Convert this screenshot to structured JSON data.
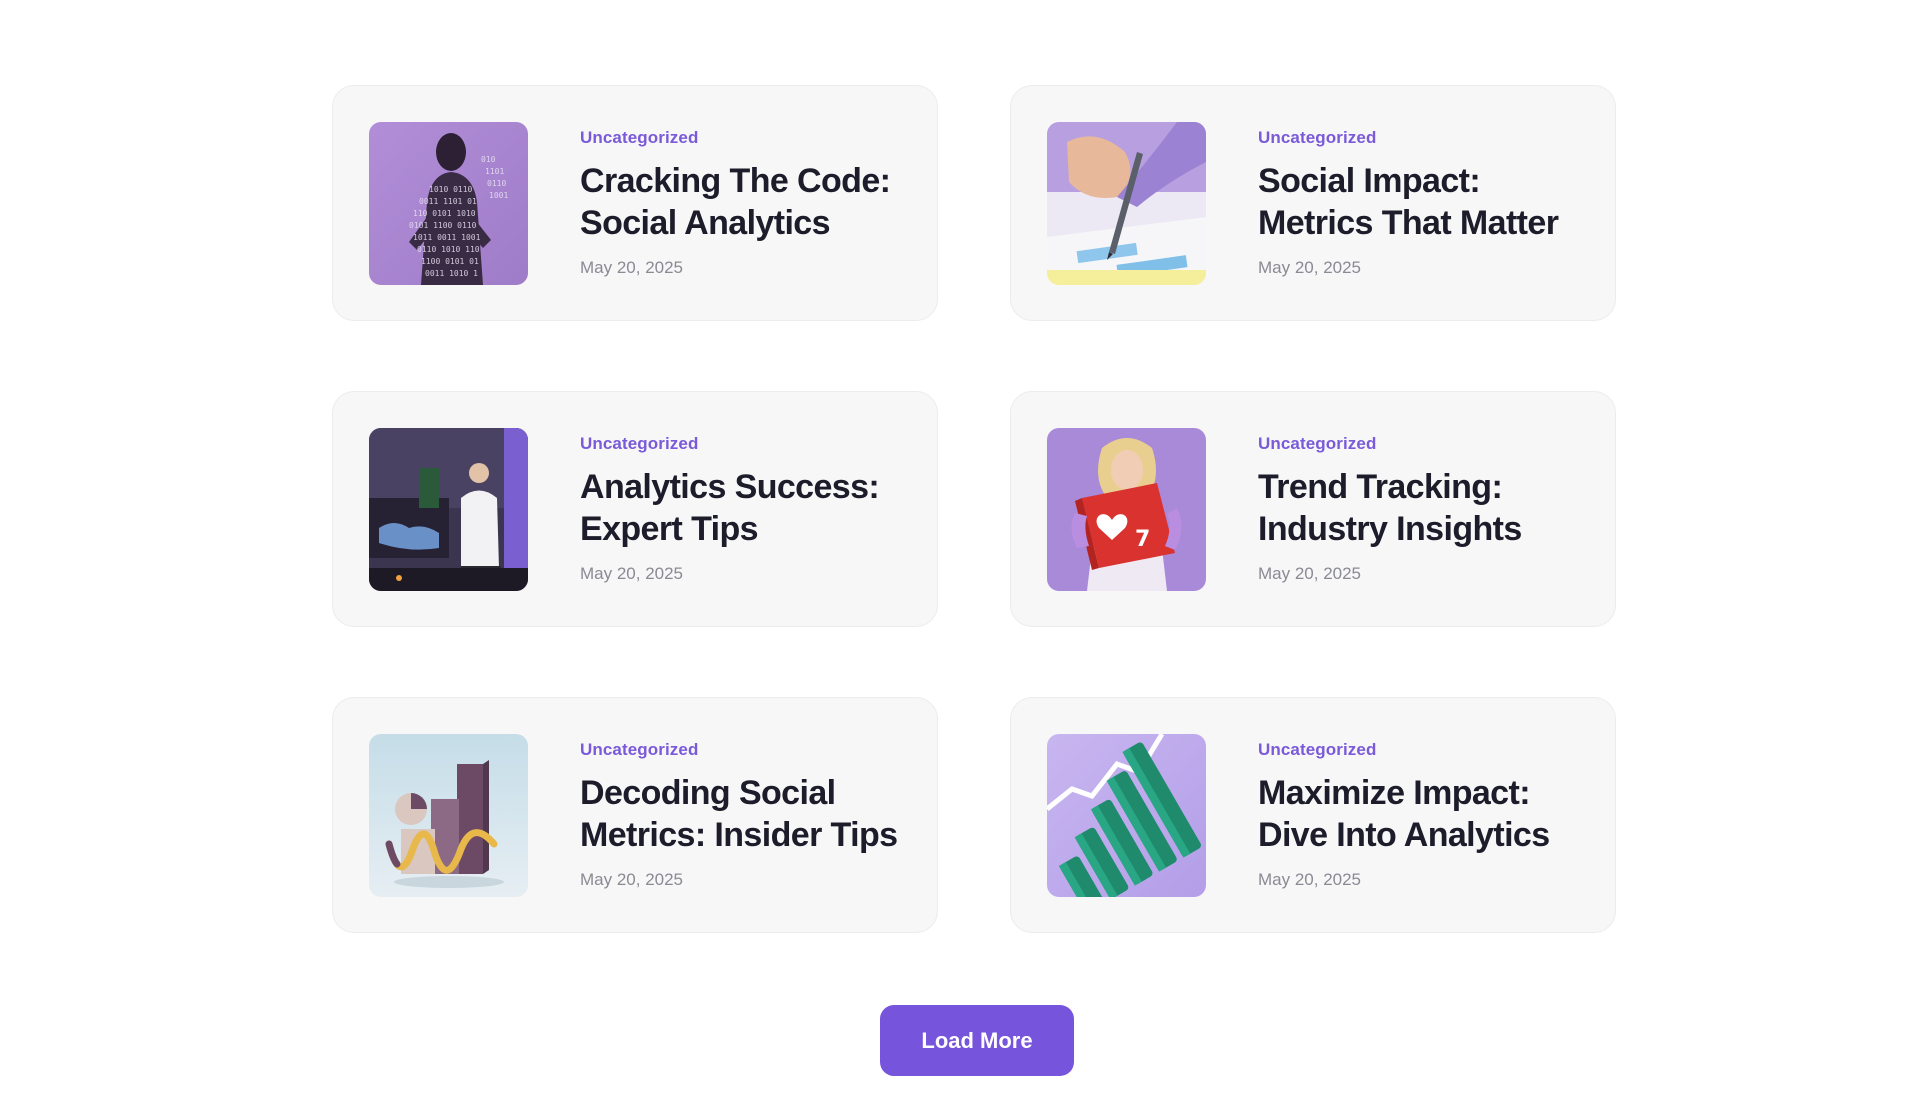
{
  "posts": [
    {
      "category": "Uncategorized",
      "title": "Cracking The Code: Social Analytics",
      "date": "May 20, 2025",
      "image_icon": "binary-projection-woman-photo"
    },
    {
      "category": "Uncategorized",
      "title": "Social Impact: Metrics That Matter",
      "date": "May 20, 2025",
      "image_icon": "hand-writing-pen-photo"
    },
    {
      "category": "Uncategorized",
      "title": "Analytics Success: Expert Tips",
      "date": "May 20, 2025",
      "image_icon": "man-at-dashboard-desk-photo"
    },
    {
      "category": "Uncategorized",
      "title": "Trend Tracking: Industry Insights",
      "date": "May 20, 2025",
      "image_icon": "woman-holding-like-pinata-photo"
    },
    {
      "category": "Uncategorized",
      "title": "Decoding Social Metrics: Insider Tips",
      "date": "May 20, 2025",
      "image_icon": "3d-bar-chart-shapes-photo"
    },
    {
      "category": "Uncategorized",
      "title": "Maximize Impact: Dive Into Analytics",
      "date": "May 20, 2025",
      "image_icon": "green-bars-trend-line-photo"
    }
  ],
  "load_more_label": "Load More",
  "colors": {
    "accent": "#7654dc",
    "category_text": "#7a5ad8",
    "card_background": "#f7f7f8",
    "title_text": "#1c1c2a",
    "date_text": "#8a8a93"
  }
}
